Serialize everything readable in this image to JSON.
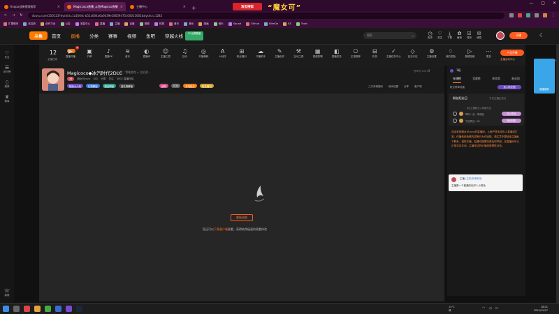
{
  "browser": {
    "tabs": [
      {
        "title": "Exopo战神视频推荐",
        "active": false
      },
      {
        "title": "Magiccoco直播_斗鱼Magicco直播",
        "active": true
      },
      {
        "title": "主播中心",
        "active": false
      }
    ],
    "url": "douyu.com/250123?dyshid=1a1664c-b51a004a6a6039e18059475c00011601&dyshci=1282",
    "promo_button": "淘宝搜索",
    "promo_banner": "“魔女可”",
    "bookmarks": [
      "扩展程序",
      "欢迎页",
      "创作平台",
      "公告",
      "流量中心",
      "直播",
      "主播",
      "百度",
      "视频",
      "热搜",
      "音乐",
      "音乐",
      "漫画",
      "音乐",
      "Squad",
      "Github",
      "BlenDa",
      "KZ",
      "Tools"
    ]
  },
  "site": {
    "logo": "斗鱼",
    "nav": [
      {
        "label": "首页",
        "active": false
      },
      {
        "label": "直播",
        "active": true
      },
      {
        "label": "分类",
        "active": false
      },
      {
        "label": "赛事",
        "active": false
      },
      {
        "label": "视频",
        "active": false
      },
      {
        "label": "鱼吧",
        "active": false
      },
      {
        "label": "穿越火线",
        "active": false
      }
    ],
    "nav_badge": "CF比赛直播",
    "search_placeholder": "搜索",
    "header_tools": [
      {
        "icon": "history-icon",
        "label": "历史"
      },
      {
        "icon": "follow-icon",
        "label": "关注"
      },
      {
        "icon": "download-icon",
        "label": "下载"
      },
      {
        "icon": "fan-icon",
        "label": "鱼粉"
      },
      {
        "icon": "task-icon",
        "label": "任务"
      },
      {
        "icon": "message-icon",
        "label": "消息"
      }
    ],
    "open_live": "开播"
  },
  "left_rail": [
    {
      "icon": "heart-icon",
      "label": "关注"
    },
    {
      "icon": "list-icon",
      "label": "排行榜"
    },
    {
      "icon": "phone-icon",
      "label": "推荐"
    },
    {
      "icon": "trophy-icon",
      "label": "赛事"
    }
  ],
  "left_rail_bottom": "客服",
  "category_bar": {
    "followers_count": "12",
    "followers_label": "主播在线",
    "noti_count": "2",
    "items": [
      {
        "icon": "▶",
        "label": "直播开播"
      },
      {
        "icon": "▣",
        "label": "开单"
      },
      {
        "icon": "♪",
        "label": "直播PK"
      },
      {
        "icon": "≋",
        "label": "音乐"
      },
      {
        "icon": "◐",
        "label": "直播间"
      },
      {
        "icon": "☺",
        "label": "主播三居"
      },
      {
        "icon": "♫",
        "label": "互动"
      },
      {
        "icon": "◎",
        "label": "开播爆款"
      },
      {
        "icon": "A",
        "label": "AI创作"
      },
      {
        "icon": "⊞",
        "label": "粉丝福利"
      },
      {
        "icon": "☁",
        "label": "口播助手"
      },
      {
        "icon": "✎",
        "label": "主播创作"
      },
      {
        "icon": "⚒",
        "label": "互动工具"
      },
      {
        "icon": "▦",
        "label": "视频剪辑"
      },
      {
        "icon": "◧",
        "label": "直播任务"
      },
      {
        "icon": "⎔",
        "label": "正常推荐"
      },
      {
        "icon": "⊟",
        "label": "礼物"
      },
      {
        "icon": "✓",
        "label": "主播任务中心"
      },
      {
        "icon": "◇",
        "label": "钻石专区"
      },
      {
        "icon": "⚙",
        "label": "主播设置"
      },
      {
        "icon": "♢",
        "label": "我的奖励"
      },
      {
        "icon": "▷",
        "label": "视频投稿"
      },
      {
        "icon": "⋯",
        "label": "更多"
      }
    ],
    "promo_side": "产品开播",
    "promo_side_sub": "主播活动中心"
  },
  "room": {
    "title": "Magicoco◆冰汽时代2DLC",
    "category": "分区：策略游戏 > 主机游...",
    "streamer": "魔女可coco",
    "level": "18",
    "meta": [
      "402",
      "分类",
      "关注",
      "3002 直播伴侣"
    ],
    "badges": [
      {
        "text": "超级大火炬",
        "color": "#6e4bc6"
      },
      {
        "text": "礼物解锁",
        "color": "#3a7bd5"
      },
      {
        "text": "魔盒揭秘",
        "color": "#2a9d8f"
      },
      {
        "text": "送礼物解锁",
        "color": "#444"
      }
    ],
    "badges2": [
      {
        "text": "冠军",
        "color": "#d64a8b"
      },
      {
        "text": "5/10",
        "color": "#666"
      },
      {
        "text": "本场统计",
        "color": "#ff7a1a"
      },
      {
        "text": "粉丝福利",
        "color": "#d4a12a"
      }
    ],
    "actions": [
      "三方商城福利",
      "房间设置",
      "分享",
      "客户端"
    ],
    "room_id": "房间号 2501"
  },
  "player": {
    "retry": "重新加载",
    "tip_pre": "您还可以",
    "tip_link": "下载客户端",
    "tip_post": "观看，获得纯净极速的观看体验"
  },
  "side": {
    "level_text": "1级",
    "tabs": [
      {
        "label": "在线榜",
        "active": true
      },
      {
        "label": "贡献榜",
        "active": false
      },
      {
        "label": "贵宾席",
        "active": false
      },
      {
        "label": "粉丝团",
        "active": false
      }
    ],
    "switch_label": "粉丝榜单设置",
    "join_label": "加入粉丝团",
    "fans_title": "粉丝纪念日",
    "fans_sub": "今日主播纪念日",
    "fans_line": "0位主播粉丝入场通行证",
    "ranks": [
      {
        "name": "啊呜～也…等候区",
        "pill": "加入粉丝"
      },
      {
        "name": "下回再见～ID",
        "pill": "粉丝特权"
      }
    ],
    "notice": "欢迎来到魔女可coco的直播间。斗鱼严禁未成年人直播或打赏，传播低俗色情内容等行为均违规。请注意不要轻信主播私下联系，谨防诈骗，如遇可疑情况请及时举报。在直播间可以正常交友互动，主播传达的价值观请理性对待。",
    "host_name": "主播",
    "host_role": "(主机游戏新任)",
    "host_msg": "主播是一个普通的也好人小角色"
  },
  "ad_card": "直播福利",
  "taskbar": {
    "weather": "15°C\n晴",
    "clock_time": "18:01",
    "clock_date": "2025/12/27"
  }
}
